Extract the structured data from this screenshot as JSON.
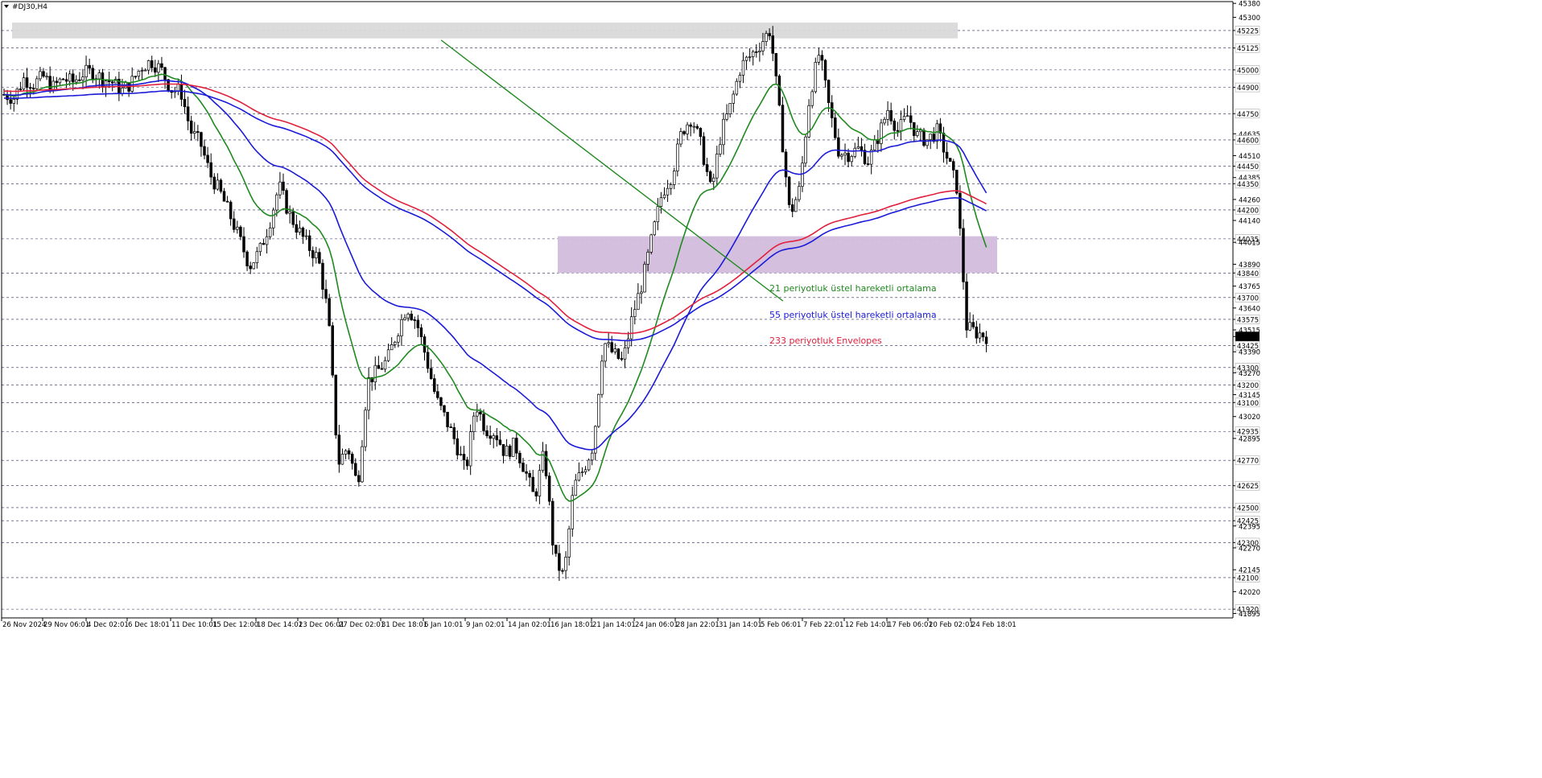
{
  "window": {
    "title": "#DJ30,H4",
    "menu_icon": "triangle-down-icon"
  },
  "chart_data": {
    "type": "candlestick",
    "symbol": "#DJ30",
    "timeframe": "H4",
    "ylim": [
      41870,
      45390
    ],
    "grid": "horizontal dashed at highlighted levels",
    "price_ticks_plain": [
      45380,
      45300,
      45225,
      45125,
      45000,
      44900,
      44750,
      44635,
      44600,
      44510,
      44450,
      44385,
      44350,
      44260,
      44200,
      44140,
      44035,
      44015,
      43890,
      43840,
      43765,
      43700,
      43640,
      43575,
      43515,
      43477,
      43425,
      43390,
      43300,
      43270,
      43200,
      43145,
      43100,
      43020,
      42935,
      42895,
      42770,
      42625,
      42500,
      42425,
      42395,
      42300,
      42270,
      42145,
      42100,
      42020,
      41920,
      41895
    ],
    "price_ticks_highlighted": [
      45225,
      45125,
      45000,
      44900,
      44750,
      44600,
      44450,
      44350,
      44200,
      44035,
      43840,
      43700,
      43575,
      43425,
      43300,
      43200,
      43100,
      42935,
      42770,
      42625,
      42500,
      42425,
      42300,
      42100,
      41920
    ],
    "current_price": "43477",
    "time_ticks": [
      "26 Nov 2024",
      "29 Nov 06:01",
      "4 Dec 02:01",
      "6 Dec 18:01",
      "11 Dec 10:01",
      "15 Dec 12:00",
      "18 Dec 14:01",
      "23 Dec 06:01",
      "27 Dec 02:01",
      "31 Dec 18:01",
      "6 Jan 10:01",
      "9 Jan 02:01",
      "14 Jan 02:01",
      "16 Jan 18:01",
      "21 Jan 14:01",
      "24 Jan 06:01",
      "28 Jan 22:01",
      "31 Jan 14:01",
      "5 Feb 06:01",
      "7 Feb 22:01",
      "12 Feb 14:01",
      "17 Feb 06:01",
      "20 Feb 02:01",
      "24 Feb 18:01"
    ],
    "legend": [
      {
        "label": "21 periyotluk üstel hareketli ortalama",
        "color": "#1f8a1f"
      },
      {
        "label": "55 periyotluk üstel hareketli ortalama",
        "color": "#1a1ad8"
      },
      {
        "label": "233 periyotluk Envelopes",
        "color": "#e0203c"
      }
    ],
    "zones": [
      {
        "name": "resistance",
        "from": 45180,
        "to": 45270,
        "color": "#d9d9d9"
      },
      {
        "name": "support-resistance",
        "from": 43840,
        "to": 44050,
        "color": "#d3bcdc"
      }
    ],
    "trendline": {
      "color": "#1f8a1f",
      "from": [
        44.5,
        45170
      ],
      "to": [
        79.3,
        43680
      ]
    },
    "closes": [
      44860,
      44840,
      44950,
      44920,
      44960,
      44900,
      44950,
      44930,
      44980,
      44990,
      44950,
      44930,
      44880,
      44930,
      45020,
      45050,
      45000,
      44890,
      44880,
      44650,
      44580,
      44400,
      44300,
      44170,
      44030,
      43880,
      43960,
      44120,
      44340,
      44180,
      44080,
      43990,
      43920,
      43600,
      42750,
      42850,
      42620,
      43220,
      43280,
      43340,
      43500,
      43650,
      43560,
      43350,
      43120,
      43000,
      42870,
      42700,
      43100,
      42950,
      42930,
      42810,
      42860,
      42720,
      42550,
      42820,
      42220,
      42100,
      42620,
      42720,
      42860,
      43450,
      43380,
      43330,
      43600,
      43790,
      44050,
      44300,
      44400,
      44650,
      44730,
      44560,
      44300,
      44640,
      44800,
      45020,
      45080,
      45150,
      45230,
      44720,
      44170,
      44320,
      44850,
      45100,
      44780,
      44530,
      44520,
      44550,
      44480,
      44620,
      44780,
      44650,
      44740,
      44620,
      44600,
      44650,
      44500,
      44330,
      43530,
      43500,
      43480
    ]
  }
}
